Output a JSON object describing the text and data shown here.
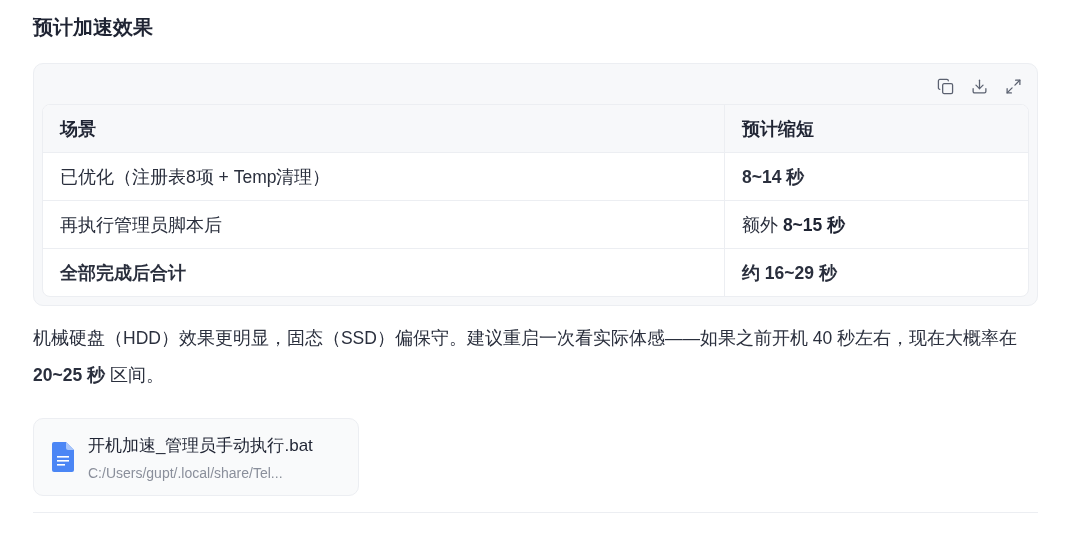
{
  "heading": "预计加速效果",
  "table": {
    "toolbar": [
      {
        "kind": "copy"
      },
      {
        "kind": "download"
      },
      {
        "kind": "expand"
      }
    ],
    "columns": [
      "场景",
      "预计缩短"
    ],
    "rows": [
      {
        "cells": [
          {
            "text": "已优化（注册表8项 + Temp清理）",
            "bold": false
          },
          {
            "text": "8~14 秒",
            "bold": true
          }
        ]
      },
      {
        "cells": [
          {
            "text": "再执行管理员脚本后",
            "bold": false
          },
          {
            "text": "额外 **8~15 秒**",
            "bold": false
          }
        ]
      },
      {
        "cells": [
          {
            "text": "全部完成后合计",
            "bold": true
          },
          {
            "text": "约 16~29 秒",
            "bold": true
          }
        ]
      }
    ]
  },
  "paragraph": "机械硬盘（HDD）效果更明显，固态（SSD）偏保守。建议重启一次看实际体感——如果之前开机 40 秒左右，现在大概率在 **20~25 秒** 区间。",
  "file": {
    "name": "开机加速_管理员手动执行.bat",
    "path": "C:/Users/gupt/.local/share/Tel..."
  }
}
